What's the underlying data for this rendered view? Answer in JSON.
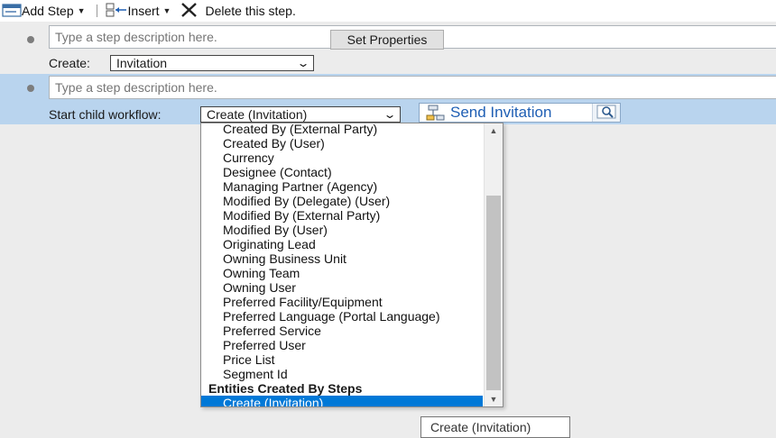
{
  "toolbar": {
    "add_step_label": "Add Step",
    "insert_label": "Insert",
    "delete_label": "Delete this step."
  },
  "steps": [
    {
      "description_placeholder": "Type a step description here.",
      "field_label": "Create:",
      "select_value": "Invitation",
      "button_label": "Set Properties"
    },
    {
      "description_placeholder": "Type a step description here.",
      "field_label": "Start child workflow:",
      "select_value": "Create (Invitation)",
      "lookup_value": "Send Invitation"
    }
  ],
  "dropdown": {
    "items": [
      "Created By (External Party)",
      "Created By (User)",
      "Currency",
      "Designee (Contact)",
      "Managing Partner (Agency)",
      "Modified By (Delegate) (User)",
      "Modified By (External Party)",
      "Modified By (User)",
      "Originating Lead",
      "Owning Business Unit",
      "Owning Team",
      "Owning User",
      "Preferred Facility/Equipment",
      "Preferred Language (Portal Language)",
      "Preferred Service",
      "Preferred User",
      "Price List",
      "Segment Id"
    ],
    "group_header": "Entities Created By Steps",
    "selected_item": "Create (Invitation)"
  },
  "tooltip": "Create (Invitation)",
  "colors": {
    "selected_row_bg": "#b9d4ee",
    "selection_highlight": "#0078d7",
    "lookup_text": "#1f5fb4"
  }
}
